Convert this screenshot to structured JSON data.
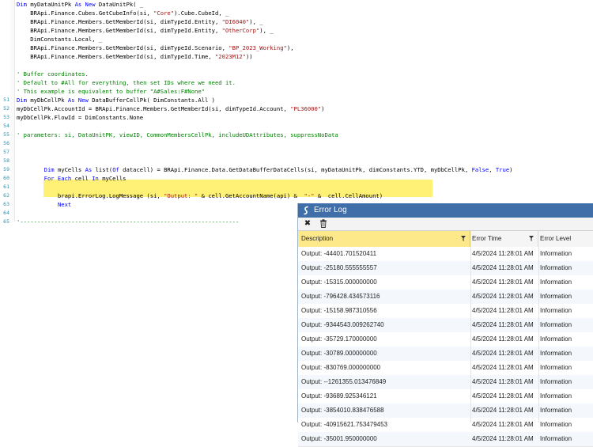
{
  "editor": {
    "lines": [
      {
        "n": "",
        "tokens": [
          {
            "c": "kw",
            "t": "Dim "
          },
          {
            "c": "",
            "t": "myDataUnitPk "
          },
          {
            "c": "kw",
            "t": "As New "
          },
          {
            "c": "",
            "t": "DataUnitPk( _"
          }
        ]
      },
      {
        "n": "",
        "tokens": [
          {
            "c": "",
            "t": "    BRApi.Finance.Cubes.GetCubeInfo(si, "
          },
          {
            "c": "str",
            "t": "\"Core\""
          },
          {
            "c": "",
            "t": ").Cube.CubeId, _"
          }
        ]
      },
      {
        "n": "",
        "tokens": [
          {
            "c": "",
            "t": "    BRApi.Finance.Members.GetMemberId(si, dimTypeId.Entity, "
          },
          {
            "c": "str",
            "t": "\"DI6040\""
          },
          {
            "c": "",
            "t": "), _"
          }
        ]
      },
      {
        "n": "",
        "tokens": [
          {
            "c": "",
            "t": "    BRApi.Finance.Members.GetMemberId(si, dimTypeId.Entity, "
          },
          {
            "c": "str",
            "t": "\"OtherCorp\""
          },
          {
            "c": "",
            "t": "), _"
          }
        ]
      },
      {
        "n": "",
        "tokens": [
          {
            "c": "",
            "t": "    DimConstants.Local, _"
          }
        ]
      },
      {
        "n": "",
        "tokens": [
          {
            "c": "",
            "t": "    BRApi.Finance.Members.GetMemberId(si, dimTypeId.Scenario, "
          },
          {
            "c": "str",
            "t": "\"BP_2023_Working\""
          },
          {
            "c": "",
            "t": "),"
          }
        ]
      },
      {
        "n": "",
        "tokens": [
          {
            "c": "",
            "t": "    BRApi.Finance.Members.GetMemberId(si, dimTypeId.Time, "
          },
          {
            "c": "str",
            "t": "\"2023M12\""
          },
          {
            "c": "",
            "t": "))"
          }
        ]
      },
      {
        "n": "",
        "tokens": []
      },
      {
        "n": "",
        "tokens": [
          {
            "c": "cmt",
            "t": "' Buffer coordinates."
          }
        ]
      },
      {
        "n": "",
        "tokens": [
          {
            "c": "cmt",
            "t": "' Default to #All for everything, then set IDs where we need it."
          }
        ]
      },
      {
        "n": "",
        "tokens": [
          {
            "c": "cmt",
            "t": "' This example is equivalent to buffer \"A#Sales:F#None\""
          }
        ]
      },
      {
        "n": "51",
        "tokens": [
          {
            "c": "kw",
            "t": "Dim "
          },
          {
            "c": "",
            "t": "myDbCellPk "
          },
          {
            "c": "kw",
            "t": "As New "
          },
          {
            "c": "",
            "t": "DataBufferCellPk( DimConstants.All )"
          }
        ]
      },
      {
        "n": "52",
        "tokens": [
          {
            "c": "",
            "t": "myDbCellPk.AccountId = BRApi.Finance.Members.GetMemberId(si, dimTypeId.Account, "
          },
          {
            "c": "str",
            "t": "\"PL36000\""
          },
          {
            "c": "",
            "t": ")"
          }
        ]
      },
      {
        "n": "53",
        "tokens": [
          {
            "c": "",
            "t": "myDbCellPk.FlowId = DimConstants.None"
          }
        ]
      },
      {
        "n": "54",
        "tokens": []
      },
      {
        "n": "55",
        "tokens": [
          {
            "c": "cmt",
            "t": "' parameters: si, DataUnitPK, viewID, CommonMembersCellPk, includeUDAttributes, suppressNoData"
          }
        ]
      },
      {
        "n": "56",
        "tokens": []
      },
      {
        "n": "57",
        "tokens": []
      },
      {
        "n": "58",
        "tokens": []
      },
      {
        "n": "59",
        "tokens": [
          {
            "c": "",
            "t": "        "
          },
          {
            "c": "kw",
            "t": "Dim "
          },
          {
            "c": "",
            "t": "myCells "
          },
          {
            "c": "kw",
            "t": "As "
          },
          {
            "c": "",
            "t": "list("
          },
          {
            "c": "kw",
            "t": "Of "
          },
          {
            "c": "",
            "t": "datacell) = BRApi.Finance.Data.GetDataBufferDataCells(si, myDataUnitPk, dimConstants.YTD, myDbCellPk, "
          },
          {
            "c": "kw",
            "t": "False"
          },
          {
            "c": "",
            "t": ", "
          },
          {
            "c": "kw",
            "t": "True"
          },
          {
            "c": "",
            "t": ")"
          }
        ]
      },
      {
        "n": "60",
        "tokens": [
          {
            "c": "",
            "t": "        "
          },
          {
            "c": "kw",
            "t": "For Each "
          },
          {
            "c": "",
            "t": "cell "
          },
          {
            "c": "kw",
            "t": "In "
          },
          {
            "c": "",
            "t": "myCells"
          }
        ]
      },
      {
        "n": "61",
        "tokens": []
      },
      {
        "n": "62",
        "tokens": [
          {
            "c": "",
            "t": "            brapi.ErrorLog.LogMessage (si, "
          },
          {
            "c": "str",
            "t": "\"Output: \""
          },
          {
            "c": "",
            "t": " & cell.GetAccountName(api) &  "
          },
          {
            "c": "str",
            "t": "\"-\""
          },
          {
            "c": "",
            "t": " &  cell.CellAmount)"
          }
        ]
      },
      {
        "n": "63",
        "tokens": [
          {
            "c": "",
            "t": "            "
          },
          {
            "c": "kw",
            "t": "Next"
          }
        ]
      },
      {
        "n": "64",
        "tokens": []
      },
      {
        "n": "65",
        "tokens": [
          {
            "c": "cmt",
            "t": "'----------------------------------------------------------------"
          }
        ]
      }
    ]
  },
  "error_log": {
    "title": "Error Log",
    "toolbar": {
      "close_glyph": "✖",
      "delete_glyph": "🗑"
    },
    "columns": {
      "description": "Description",
      "time": "Error Time",
      "level": "Error Level"
    },
    "rows": [
      {
        "description": "Output: -44401.701520411",
        "time": "4/5/2024 11:28:01 AM",
        "level": "Information"
      },
      {
        "description": "Output: -25180.555555557",
        "time": "4/5/2024 11:28:01 AM",
        "level": "Information"
      },
      {
        "description": "Output: -15315.000000000",
        "time": "4/5/2024 11:28:01 AM",
        "level": "Information"
      },
      {
        "description": "Output: -796428.434573116",
        "time": "4/5/2024 11:28:01 AM",
        "level": "Information"
      },
      {
        "description": "Output: -15158.987310556",
        "time": "4/5/2024 11:28:01 AM",
        "level": "Information"
      },
      {
        "description": "Output: -9344543.009262740",
        "time": "4/5/2024 11:28:01 AM",
        "level": "Information"
      },
      {
        "description": "Output: -35729.170000000",
        "time": "4/5/2024 11:28:01 AM",
        "level": "Information"
      },
      {
        "description": "Output: -30789.000000000",
        "time": "4/5/2024 11:28:01 AM",
        "level": "Information"
      },
      {
        "description": "Output: -830769.000000000",
        "time": "4/5/2024 11:28:01 AM",
        "level": "Information"
      },
      {
        "description": "Output: --1261355.013476849",
        "time": "4/5/2024 11:28:01 AM",
        "level": "Information"
      },
      {
        "description": "Output: -93689.925346121",
        "time": "4/5/2024 11:28:01 AM",
        "level": "Information"
      },
      {
        "description": "Output: -3854010.838476588",
        "time": "4/5/2024 11:28:01 AM",
        "level": "Information"
      },
      {
        "description": "Output: -40915621.753479453",
        "time": "4/5/2024 11:28:01 AM",
        "level": "Information"
      },
      {
        "description": "Output: -35001.950000000",
        "time": "4/5/2024 11:28:01 AM",
        "level": "Information"
      }
    ]
  },
  "colors": {
    "title_bar": "#3f6ea8",
    "highlight": "#fff176",
    "keyword": "#0000ff",
    "string": "#a31515",
    "comment": "#008000"
  }
}
